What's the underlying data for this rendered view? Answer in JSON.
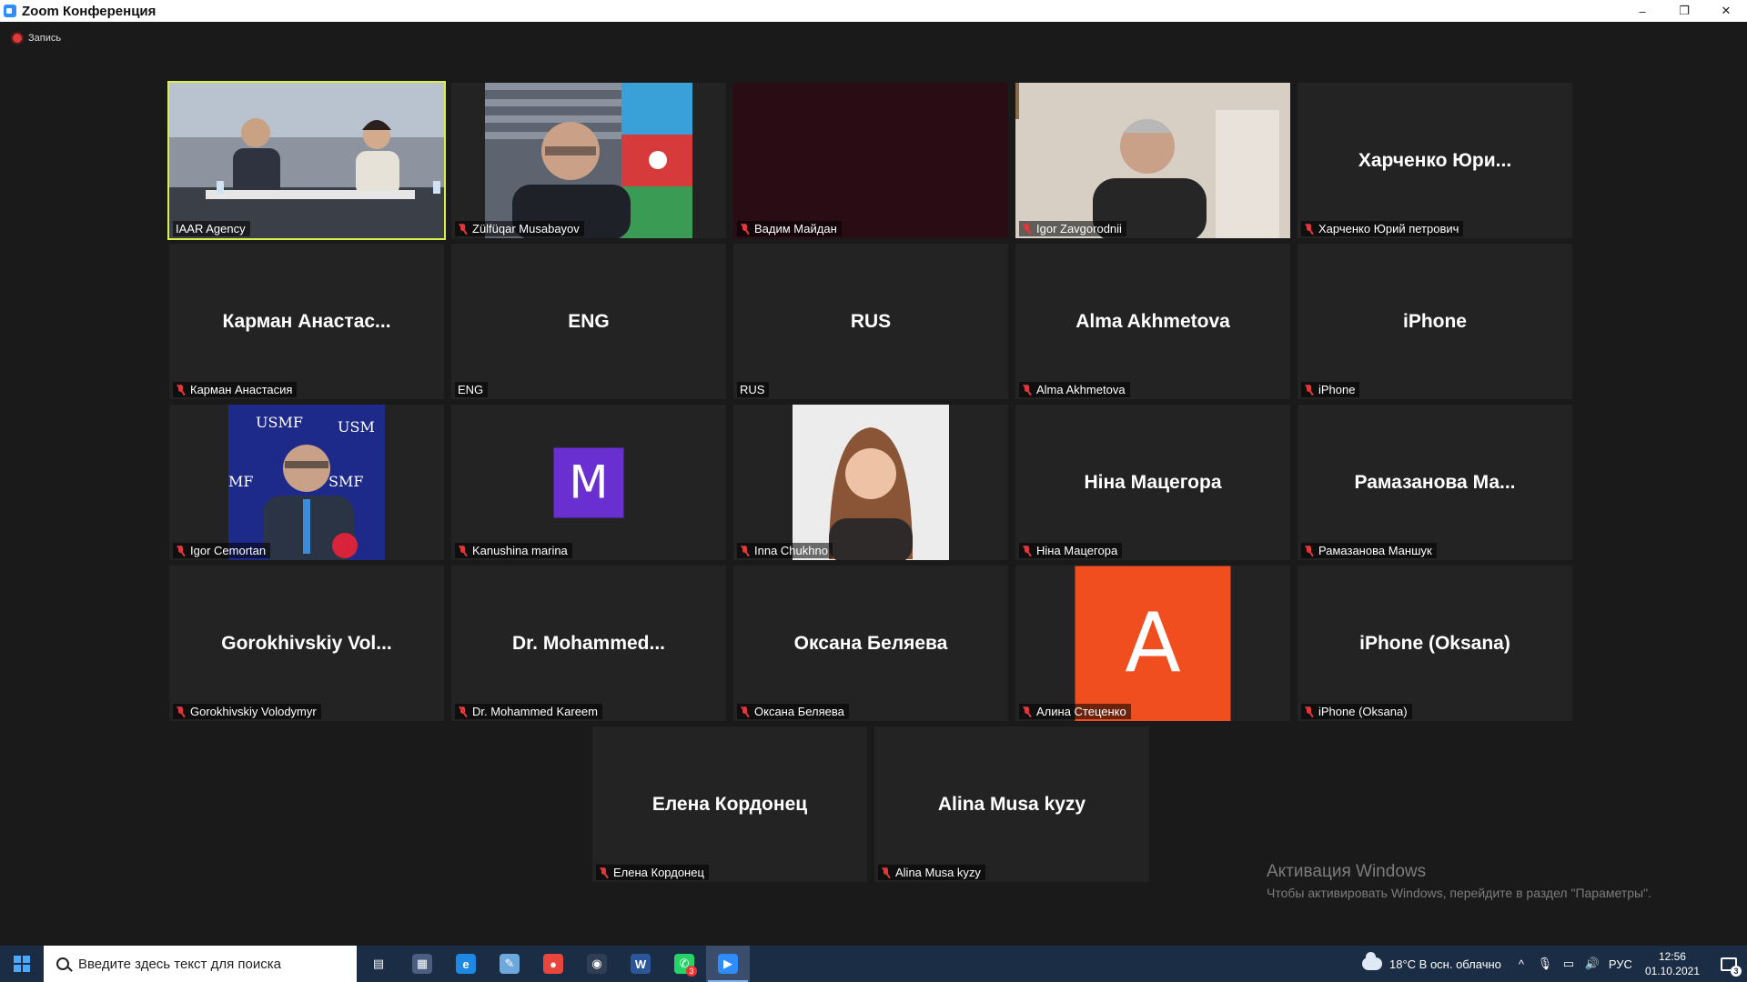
{
  "window": {
    "title": "Zoom Конференция",
    "controls": {
      "minimize": "–",
      "restore": "❐",
      "close": "✕"
    }
  },
  "recording": {
    "label": "Запись"
  },
  "tiles": [
    {
      "label": "IAAR Agency",
      "muted": false,
      "active": true,
      "type": "video",
      "scene": "conference"
    },
    {
      "label": "Zülfüqar Musabayov",
      "muted": true,
      "type": "video",
      "scene": "man-flag"
    },
    {
      "label": "Вадим Майдан",
      "muted": true,
      "type": "video",
      "scene": "dark"
    },
    {
      "label": "Igor Zavgorodnii",
      "muted": true,
      "type": "video",
      "scene": "man-grey"
    },
    {
      "label": "Харченко Юрий петрович",
      "display": "Харченко Юри...",
      "muted": true,
      "type": "name"
    },
    {
      "label": "Карман Анастасия",
      "display": "Карман Анастас...",
      "muted": true,
      "type": "name"
    },
    {
      "label": "ENG",
      "display": "ENG",
      "muted": false,
      "type": "name"
    },
    {
      "label": "RUS",
      "display": "RUS",
      "muted": false,
      "type": "name"
    },
    {
      "label": "Alma Akhmetova",
      "display": "Alma Akhmetova",
      "muted": true,
      "type": "name"
    },
    {
      "label": "iPhone",
      "display": "iPhone",
      "muted": true,
      "type": "name"
    },
    {
      "label": "Igor Cemortan",
      "muted": true,
      "type": "video",
      "scene": "usmf"
    },
    {
      "label": "Kanushina marina",
      "muted": true,
      "type": "avatar",
      "letter": "M",
      "color": "#6a2fd0"
    },
    {
      "label": "Inna Chukhno",
      "muted": true,
      "type": "video",
      "scene": "woman"
    },
    {
      "label": "Ніна Мацегора",
      "display": "Ніна Мацегора",
      "muted": true,
      "type": "name"
    },
    {
      "label": "Рамазанова Маншук",
      "display": "Рамазанова Ма...",
      "muted": true,
      "type": "name"
    },
    {
      "label": "Gorokhivskiy Volodymyr",
      "display": "Gorokhivskiy Vol...",
      "muted": true,
      "type": "name"
    },
    {
      "label": "Dr. Mohammed Kareem",
      "display": "Dr. Mohammed...",
      "muted": true,
      "type": "name"
    },
    {
      "label": "Оксана Беляева",
      "display": "Оксана Беляева",
      "muted": true,
      "type": "name"
    },
    {
      "label": "Алина Стеценко",
      "muted": true,
      "type": "avatar",
      "letter": "A",
      "color": "#f04e1e"
    },
    {
      "label": "iPhone (Oksana)",
      "display": "iPhone (Oksana)",
      "muted": true,
      "type": "name"
    },
    {
      "label": "Елена Кордонец",
      "display": "Елена Кордонец",
      "muted": true,
      "type": "name"
    },
    {
      "label": "Alina Musa kyzy",
      "display": "Alina Musa kyzy",
      "muted": true,
      "type": "name"
    }
  ],
  "activation": {
    "title": "Активация Windows",
    "subtitle": "Чтобы активировать Windows, перейдите в раздел \"Параметры\"."
  },
  "taskbar": {
    "search_placeholder": "Введите здесь текст для поиска",
    "apps": [
      {
        "name": "task-view",
        "glyph": "▤",
        "color": "transparent"
      },
      {
        "name": "calculator",
        "glyph": "▦",
        "color": "#4a5f80"
      },
      {
        "name": "internet-explorer",
        "glyph": "e",
        "color": "#1e88e5"
      },
      {
        "name": "notes",
        "glyph": "✎",
        "color": "#6fa8dc"
      },
      {
        "name": "chrome",
        "glyph": "●",
        "color": "#e8453c"
      },
      {
        "name": "camera",
        "glyph": "◉",
        "color": "#2f3d55"
      },
      {
        "name": "word",
        "glyph": "W",
        "color": "#2b579a"
      },
      {
        "name": "whatsapp",
        "glyph": "✆",
        "color": "#25d366",
        "badge": "3"
      },
      {
        "name": "zoom",
        "glyph": "▶",
        "color": "#2d8cff",
        "active": true
      }
    ],
    "weather": "18°C  В осн. облачно",
    "tray_glyphs": {
      "chevron": "^",
      "mic": "🎙",
      "network": "▭",
      "volume": "🔊"
    },
    "language": "РУС",
    "time": "12:56",
    "date": "01.10.2021",
    "notification_count": "3"
  }
}
